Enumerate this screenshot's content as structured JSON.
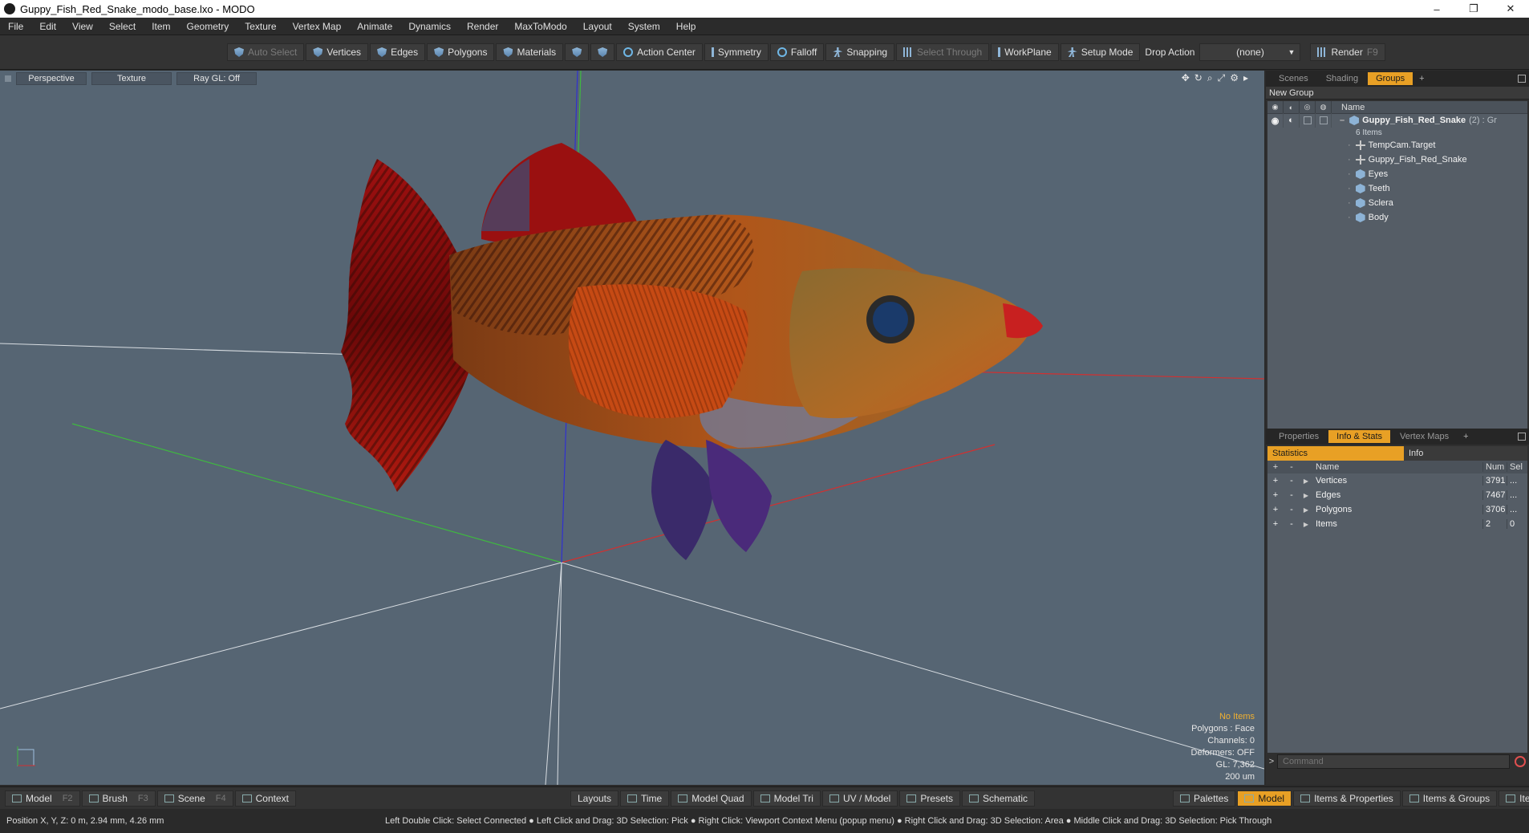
{
  "window": {
    "title": "Guppy_Fish_Red_Snake_modo_base.lxo - MODO",
    "controls": [
      "–",
      "❐",
      "✕"
    ]
  },
  "menu": [
    "File",
    "Edit",
    "View",
    "Select",
    "Item",
    "Geometry",
    "Texture",
    "Vertex Map",
    "Animate",
    "Dynamics",
    "Render",
    "MaxToModo",
    "Layout",
    "System",
    "Help"
  ],
  "toolbar": {
    "auto_select": "Auto Select",
    "vertices": "Vertices",
    "edges": "Edges",
    "polygons": "Polygons",
    "materials": "Materials",
    "action_center": "Action Center",
    "symmetry": "Symmetry",
    "falloff": "Falloff",
    "snapping": "Snapping",
    "select_through": "Select Through",
    "workplane": "WorkPlane",
    "setup_mode": "Setup Mode",
    "drop_action_label": "Drop Action",
    "drop_action_value": "(none)",
    "render": "Render",
    "render_key": "F9"
  },
  "viewport": {
    "view_mode": "Perspective",
    "shading": "Texture",
    "raygl": "Ray GL: Off",
    "stats": {
      "selection": "No Items",
      "polygons": "Polygons : Face",
      "channels": "Channels: 0",
      "deformers": "Deformers: OFF",
      "gl": "GL: 7,362",
      "scale": "200 um"
    }
  },
  "scene_panel": {
    "tabs": [
      "Scenes",
      "Shading",
      "Groups"
    ],
    "active_tab": "Groups",
    "new_group": "New Group",
    "name_header": "Name",
    "root": {
      "name": "Guppy_Fish_Red_Snake",
      "suffix": "(2) : Gr",
      "count": "6 Items"
    },
    "items": [
      "TempCam.Target",
      "Guppy_Fish_Red_Snake",
      "Eyes",
      "Teeth",
      "Sclera",
      "Body"
    ]
  },
  "props_panel": {
    "tabs": [
      "Properties",
      "Info & Stats",
      "Vertex Maps"
    ],
    "active_tab": "Info & Stats",
    "sub_tabs": [
      "Statistics",
      "Info"
    ],
    "headers": {
      "name": "Name",
      "num": "Num",
      "sel": "Sel"
    },
    "rows": [
      {
        "name": "Vertices",
        "num": "3791",
        "sel": "..."
      },
      {
        "name": "Edges",
        "num": "7467",
        "sel": "..."
      },
      {
        "name": "Polygons",
        "num": "3706",
        "sel": "..."
      },
      {
        "name": "Items",
        "num": "2",
        "sel": "0"
      }
    ],
    "command_placeholder": "Command"
  },
  "layoutbar": {
    "left": [
      {
        "label": "Model",
        "key": "F2"
      },
      {
        "label": "Brush",
        "key": "F3"
      },
      {
        "label": "Scene",
        "key": "F4"
      },
      {
        "label": "Context",
        "key": ""
      }
    ],
    "center": [
      "Layouts",
      "Time",
      "Model Quad",
      "Model Tri",
      "UV / Model",
      "Presets",
      "Schematic"
    ],
    "palettes": "Palettes",
    "model": "Model",
    "right": [
      "Items & Properties",
      "Items & Groups",
      "Items & Shading"
    ]
  },
  "statusbar": {
    "position": "Position X, Y, Z:   0 m, 2.94 mm, 4.26 mm",
    "hints": "Left Double Click: Select Connected ● Left Click and Drag: 3D Selection: Pick ● Right Click: Viewport Context Menu (popup menu) ● Right Click and Drag: 3D Selection: Area ● Middle Click and Drag: 3D Selection: Pick Through"
  },
  "colors": {
    "accent": "#e8a025",
    "viewport_bg": "#566573"
  }
}
